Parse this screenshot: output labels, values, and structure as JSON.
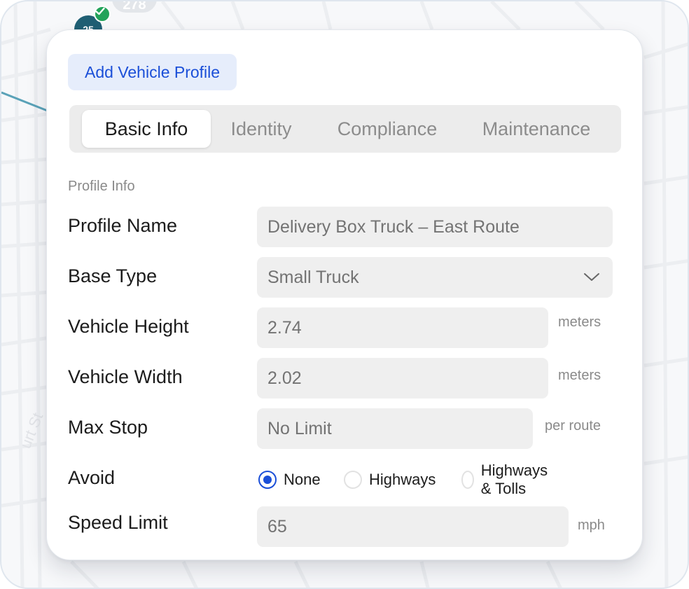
{
  "map": {
    "marker_number": "25",
    "marker_ghost_number": "278",
    "street_label": "urt St"
  },
  "panel": {
    "title": "Add Vehicle Profile",
    "tabs": [
      {
        "label": "Basic Info",
        "active": true
      },
      {
        "label": "Identity",
        "active": false
      },
      {
        "label": "Compliance",
        "active": false
      },
      {
        "label": "Maintenance",
        "active": false
      }
    ],
    "section_label": "Profile Info",
    "fields": {
      "profile_name": {
        "label": "Profile Name",
        "value": "Delivery Box Truck – East Route"
      },
      "base_type": {
        "label": "Base Type",
        "value": "Small Truck"
      },
      "vehicle_height": {
        "label": "Vehicle Height",
        "value": "2.74",
        "unit": "meters"
      },
      "vehicle_width": {
        "label": "Vehicle Width",
        "value": "2.02",
        "unit": "meters"
      },
      "max_stop": {
        "label": "Max Stop",
        "value": "No Limit",
        "unit": "per route"
      },
      "avoid": {
        "label": "Avoid",
        "selected": "None",
        "options": [
          "None",
          "Highways",
          "Highways & Tolls"
        ]
      },
      "speed_limit": {
        "label": "Speed Limit",
        "value": "65",
        "unit": "mph"
      }
    }
  },
  "colors": {
    "accent": "#1b4fd8",
    "title_bg": "#e6edfb",
    "field_bg": "#efefef",
    "marker": "#1f5f74",
    "check": "#22a35a",
    "route": "#5aa2b8"
  },
  "icons": {
    "marker_check": "check-icon",
    "select_chevron": "chevron-down-icon"
  }
}
